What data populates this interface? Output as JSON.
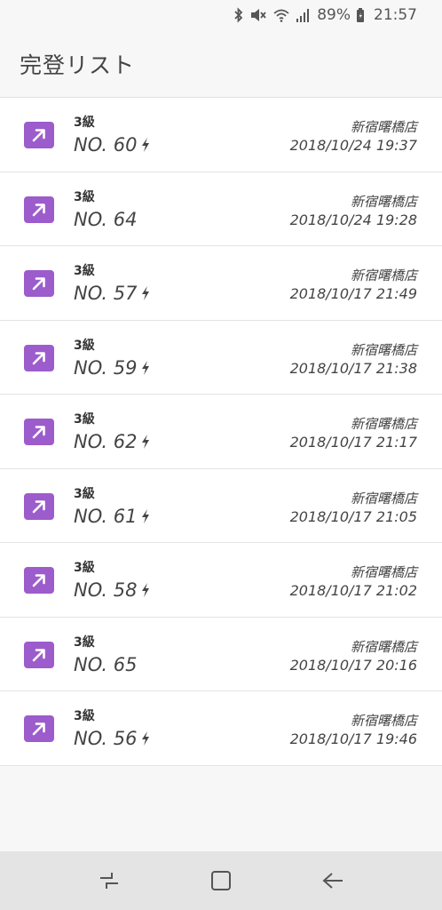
{
  "status_bar": {
    "battery": "89%",
    "time": "21:57"
  },
  "header": {
    "title": "完登リスト"
  },
  "records": [
    {
      "grade": "3級",
      "problem": "NO. 60",
      "flash": true,
      "store": "新宿曙橋店",
      "datetime": "2018/10/24 19:37"
    },
    {
      "grade": "3級",
      "problem": "NO. 64",
      "flash": false,
      "store": "新宿曙橋店",
      "datetime": "2018/10/24 19:28"
    },
    {
      "grade": "3級",
      "problem": "NO. 57",
      "flash": true,
      "store": "新宿曙橋店",
      "datetime": "2018/10/17 21:49"
    },
    {
      "grade": "3級",
      "problem": "NO. 59",
      "flash": true,
      "store": "新宿曙橋店",
      "datetime": "2018/10/17 21:38"
    },
    {
      "grade": "3級",
      "problem": "NO. 62",
      "flash": true,
      "store": "新宿曙橋店",
      "datetime": "2018/10/17 21:17"
    },
    {
      "grade": "3級",
      "problem": "NO. 61",
      "flash": true,
      "store": "新宿曙橋店",
      "datetime": "2018/10/17 21:05"
    },
    {
      "grade": "3級",
      "problem": "NO. 58",
      "flash": true,
      "store": "新宿曙橋店",
      "datetime": "2018/10/17 21:02"
    },
    {
      "grade": "3級",
      "problem": "NO. 65",
      "flash": false,
      "store": "新宿曙橋店",
      "datetime": "2018/10/17 20:16"
    },
    {
      "grade": "3級",
      "problem": "NO. 56",
      "flash": true,
      "store": "新宿曙橋店",
      "datetime": "2018/10/17 19:46"
    }
  ],
  "colors": {
    "record_icon": "#9c5ccc",
    "background": "#f7f7f7",
    "nav_bar": "#e4e4e4"
  },
  "icons": {
    "record": "arrow-up-right-icon",
    "flash": "lightning-bolt-icon",
    "nav_recent": "recent-apps-icon",
    "nav_home": "home-icon",
    "nav_back": "back-icon"
  }
}
